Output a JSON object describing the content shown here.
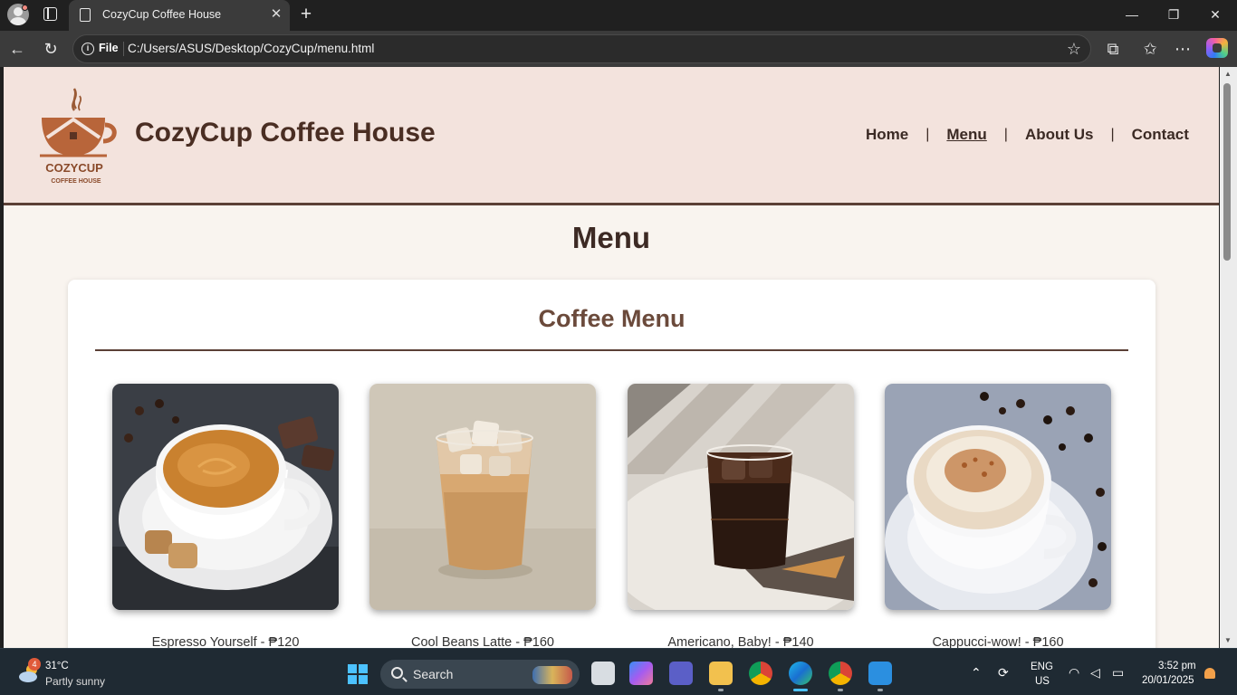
{
  "browser": {
    "tab_title": "CozyCup Coffee House",
    "omnibox_chip": "File",
    "url": "C:/Users/ASUS/Desktop/CozyCup/menu.html"
  },
  "site": {
    "title": "CozyCup Coffee House",
    "logo_text": "COZYCUP",
    "logo_subtext": "COFFEE HOUSE",
    "nav": [
      {
        "label": "Home",
        "active": false
      },
      {
        "label": "Menu",
        "active": true
      },
      {
        "label": "About Us",
        "active": false
      },
      {
        "label": "Contact",
        "active": false
      }
    ],
    "nav_separator": "|"
  },
  "page": {
    "heading": "Menu",
    "section_title": "Coffee Menu",
    "items": [
      {
        "caption": "Espresso Yourself - ₱120"
      },
      {
        "caption": "Cool Beans Latte - ₱160"
      },
      {
        "caption": "Americano, Baby! - ₱140"
      },
      {
        "caption": "Cappucci-wow! - ₱160"
      }
    ]
  },
  "taskbar": {
    "weather_badge": "4",
    "temperature": "31°C",
    "condition": "Partly sunny",
    "search_label": "Search",
    "language_line1": "ENG",
    "language_line2": "US",
    "time": "3:52 pm",
    "date": "20/01/2025"
  },
  "colors": {
    "header_bg": "#f3e3dd",
    "accent_brown": "#5b4036",
    "page_bg": "#f9f4ef"
  }
}
